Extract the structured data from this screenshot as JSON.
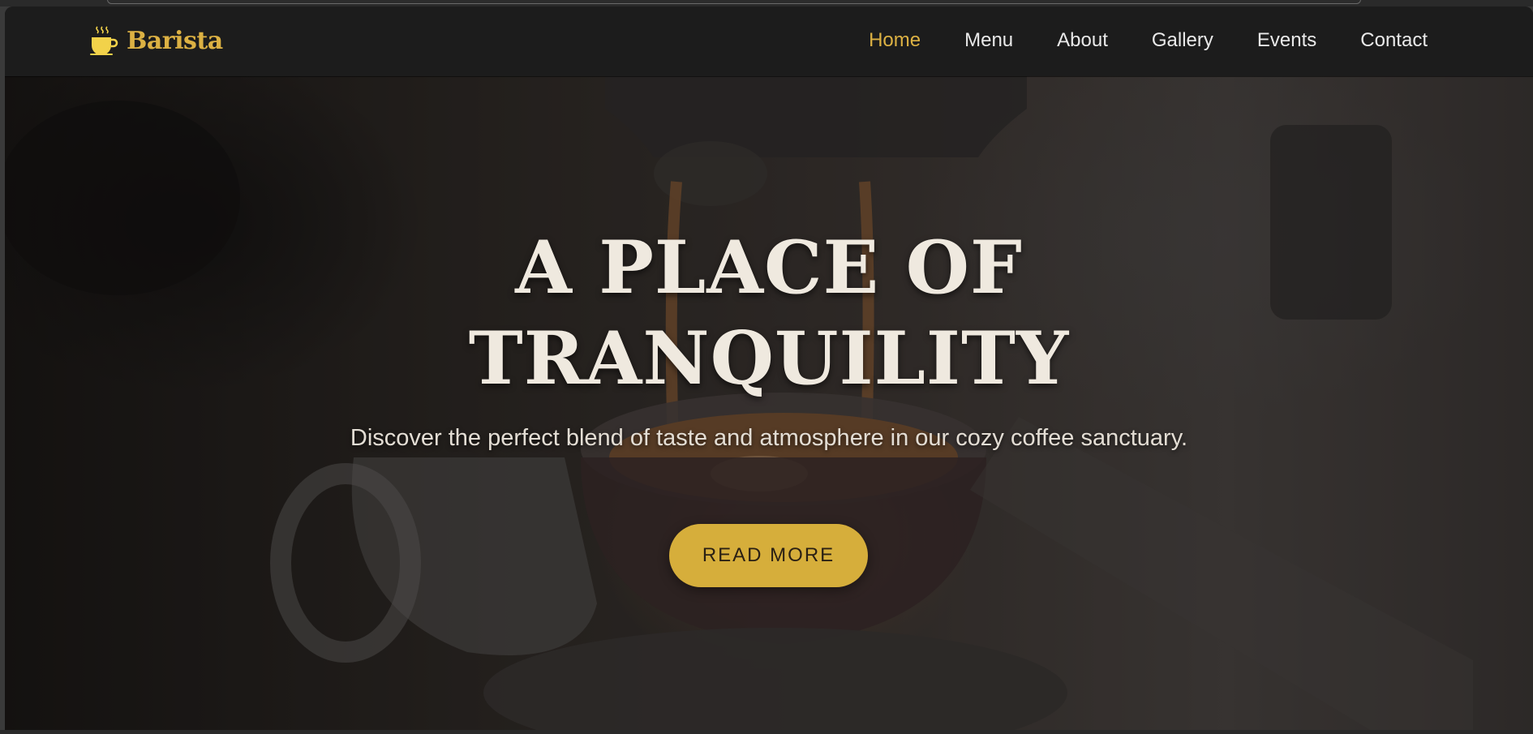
{
  "brand": {
    "name": "Barista",
    "icon": "coffee-cup-icon",
    "color": "#dcb143"
  },
  "nav": {
    "items": [
      {
        "label": "Home",
        "active": true
      },
      {
        "label": "Menu",
        "active": false
      },
      {
        "label": "About",
        "active": false
      },
      {
        "label": "Gallery",
        "active": false
      },
      {
        "label": "Events",
        "active": false
      },
      {
        "label": "Contact",
        "active": false
      }
    ]
  },
  "hero": {
    "title_line1": "A PLACE OF",
    "title_line2": "TRANQUILITY",
    "subtitle": "Discover the perfect blend of taste and atmosphere in our cozy coffee sanctuary.",
    "cta_label": "READ MORE",
    "background": "espresso-machine-pour-photo"
  },
  "colors": {
    "accent": "#d6ae3b",
    "navbar": "#1c1c1c",
    "text": "#efe9df"
  }
}
